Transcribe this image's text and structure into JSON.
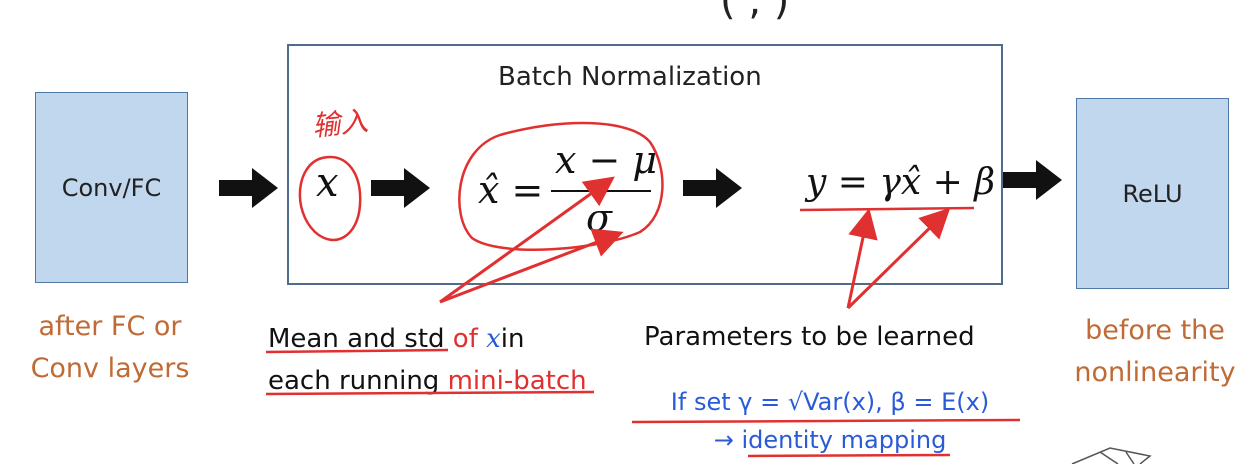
{
  "header_fragment": "(         ,         )",
  "bn_title": "Batch Normalization",
  "input_box": "Conv/FC",
  "output_box": "ReLU",
  "handwritten_input": "输入",
  "formula_x": "x",
  "formula_xhat_lhs": "x̂ =",
  "formula_numerator": "x − μ",
  "formula_denominator": "σ",
  "formula_y": "y = γx̂ + β",
  "left_caption": [
    "after FC or",
    "Conv layers"
  ],
  "right_caption": [
    "before the",
    "nonlinearity"
  ],
  "note_mean_std": {
    "line1_a": "Mean and std",
    "line1_b": " of ",
    "line1_x": "x",
    "line1_c": "in",
    "line2_a": "each running ",
    "line2_b": "mini-batch"
  },
  "note_params": "Parameters to be learned",
  "note_ifset": "If set γ = √Var(x), β = E(x)",
  "note_identity_arrow": "→ ",
  "note_identity": "identity mapping",
  "colors": {
    "box_fill": "#c0d7ee",
    "annotation_red": "#e03030",
    "caption_orange": "#c06a35",
    "blue_text": "#2a5bd7"
  }
}
